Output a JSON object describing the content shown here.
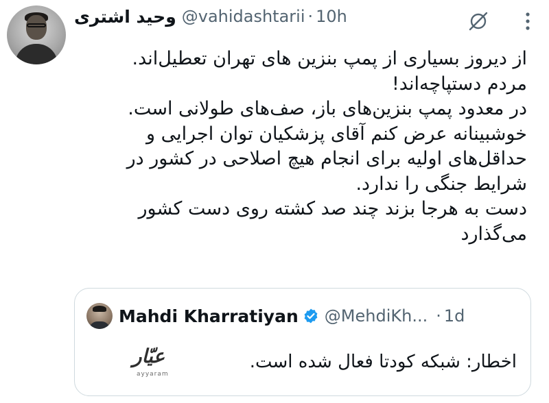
{
  "tweet": {
    "author": {
      "display_name": "وحید اشتری",
      "handle": "@vahidashtarii",
      "time": "10h"
    },
    "separator": "·",
    "icons": {
      "ai": "grok-icon",
      "more": "more-vertical-icon"
    },
    "lines": [
      "از دیروز بسیاری از پمپ بنزین های تهران تعطیل‌اند.",
      "مردم دستپاچه‌اند!",
      "در معدود پمپ بنزین‌های باز، صف‌های طولانی است.",
      "خوشبینانه عرض کنم آقای پزشکیان توان اجرایی و",
      "حداقل‌های اولیه برای انجام هیچ اصلاحی در کشور در",
      "شرایط جنگی را ندارد.",
      "دست به هرجا بزند چند صد کشته روی دست کشور",
      "می‌گذارد"
    ]
  },
  "quote": {
    "author": {
      "display_name": "Mahdi Kharratiyan",
      "verified": true,
      "handle": "@MehdiKh...",
      "time": "1d"
    },
    "separator": "·",
    "logo": {
      "arabic": "عیّار",
      "latin": "ayyaram"
    },
    "text": "اخطار: شبکه کودتا فعال شده است.",
    "colors": {
      "verified": "#1d9bf0",
      "border": "#cfd9de",
      "secondary_text": "#536471"
    }
  }
}
